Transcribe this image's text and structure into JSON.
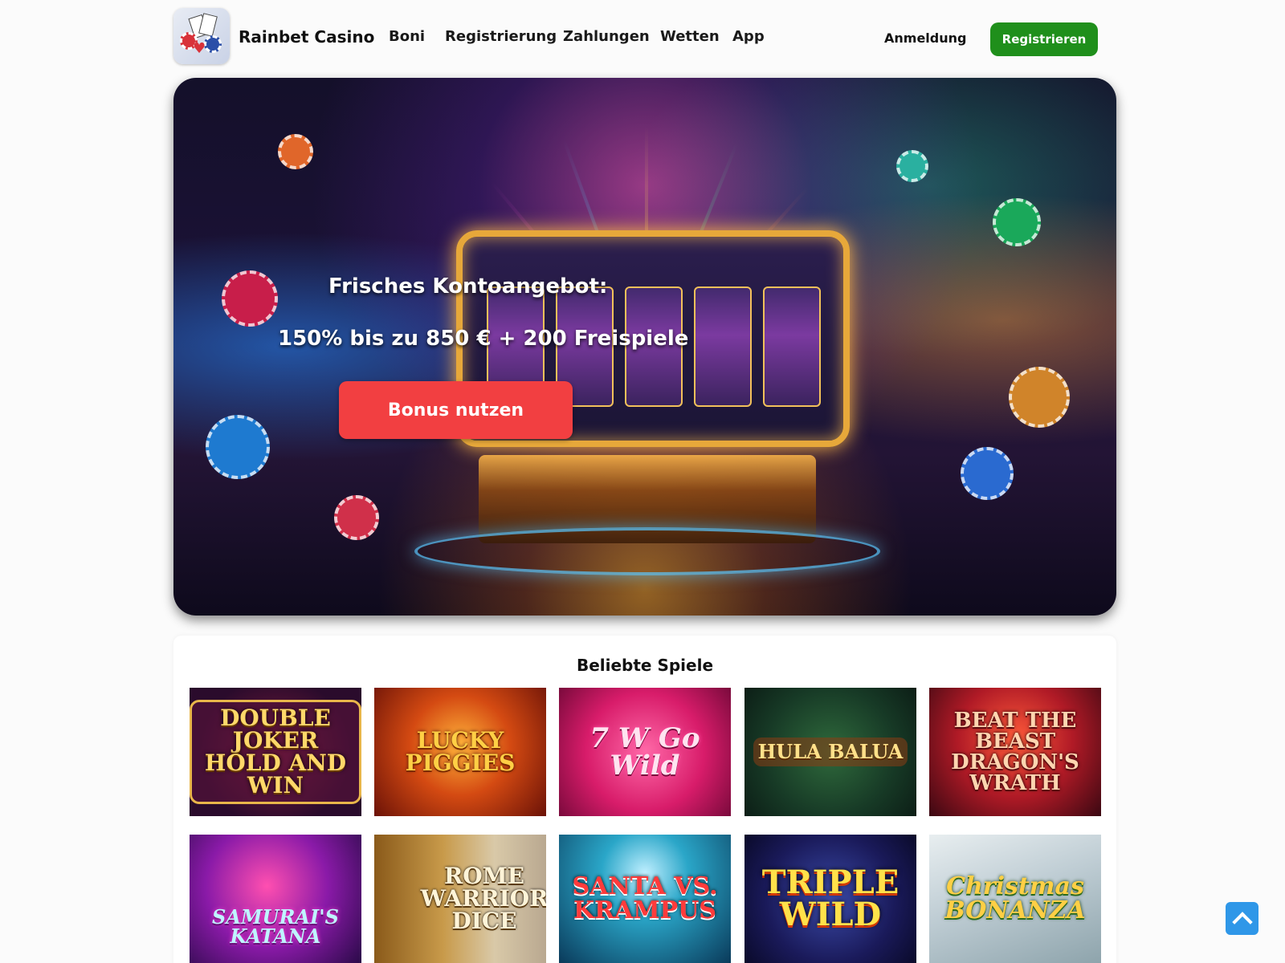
{
  "header": {
    "brand": "Rainbet Casino",
    "nav": [
      "Boni",
      "Registrierung",
      "Zahlungen",
      "Wetten",
      "App"
    ],
    "login_label": "Anmeldung",
    "register_label": "Registrieren",
    "register_color": "#1f8f1b"
  },
  "hero": {
    "title": "Frisches Kontoangebot:",
    "offer": "150% bis zu 850 € + 200 Freispiele",
    "cta_label": "Bonus nutzen",
    "cta_color": "#f23f41"
  },
  "games": {
    "title": "Beliebte Spiele",
    "items": [
      {
        "name": "DOUBLE JOKER HOLD AND WIN"
      },
      {
        "name": "LUCKY PIGGIES"
      },
      {
        "name": "7 W Go Wild"
      },
      {
        "name": "HULA BALUA"
      },
      {
        "name": "BEAT THE BEAST DRAGON'S WRATH"
      },
      {
        "name": "SAMURAI'S KATANA"
      },
      {
        "name": "ROME WARRIOR DICE"
      },
      {
        "name": "SANTA VS. KRAMPUS"
      },
      {
        "name": "TRIPLE WILD"
      },
      {
        "name": "Christmas BONANZA"
      }
    ]
  },
  "icons": {
    "logo": "casino-logo-icon",
    "scroll_top": "chevron-up-icon"
  }
}
